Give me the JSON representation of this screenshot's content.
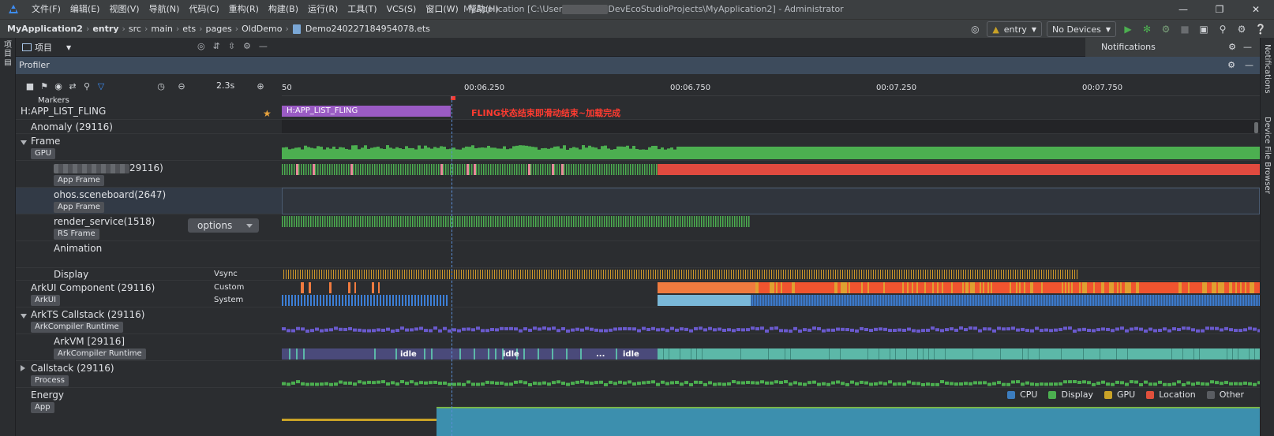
{
  "window": {
    "menus": [
      "文件(F)",
      "编辑(E)",
      "视图(V)",
      "导航(N)",
      "代码(C)",
      "重构(R)",
      "构建(B)",
      "运行(R)",
      "工具(T)",
      "VCS(S)",
      "窗口(W)",
      "帮助(H)"
    ],
    "title_pre": "MyApplication [C:\\User",
    "title_post": "DevEcoStudioProjects\\MyApplication2] - Administrator"
  },
  "nav": {
    "crumbs": [
      "MyApplication2",
      "entry",
      "src",
      "main",
      "ets",
      "pages",
      "OldDemo"
    ],
    "file": "Demo240227184954078.ets",
    "module_select": "entry",
    "device_select": "No Devices"
  },
  "tool": {
    "project_label": "项目",
    "notifications_label": "Notifications",
    "profiler_label": "Profiler",
    "left_stripe": [
      "项目"
    ],
    "right_stripe_notifications": "Notifications",
    "right_stripe_device": "Device File Browser"
  },
  "profiler": {
    "zoom": "2.3s",
    "ticks": [
      {
        "label": "50",
        "t": 0
      },
      {
        "label": "00:06.250",
        "t": 1
      },
      {
        "label": "00:06.750",
        "t": 2
      },
      {
        "label": "00:07.250",
        "t": 3
      },
      {
        "label": "00:07.750",
        "t": 4
      }
    ],
    "markers_title": "Markers",
    "marker_name": "H:APP_LIST_FLING",
    "marker_bar": "H:APP_LIST_FLING",
    "marker_note": "FLING状态结束即滑动结束~加载完成",
    "rows": {
      "anomaly": "Anomaly (29116)",
      "frame": "Frame",
      "frame_tag": "GPU",
      "app_frame_suffix": "29116)",
      "app_frame_tag": "App Frame",
      "sceneboard": "ohos.sceneboard(2647)",
      "sceneboard_tag": "App Frame",
      "render_service": "render_service(1518)",
      "render_tag": "RS Frame",
      "options": "options",
      "animation": "Animation",
      "display": "Display",
      "vsync": "Vsync",
      "arkui": "ArkUI Component (29116)",
      "arkui_tag": "ArkUI",
      "custom": "Custom",
      "system": "System",
      "arkts": "ArkTS Callstack (29116)",
      "arkts_tag": "ArkCompiler Runtime",
      "arkvm": "ArkVM [29116]",
      "arkvm_tag": "ArkCompiler Runtime",
      "callstack": "Callstack (29116)",
      "callstack_tag": "Process",
      "energy": "Energy",
      "energy_tag": "App"
    },
    "idle_labels": [
      "idle",
      "idle",
      "...",
      "idle"
    ],
    "legend": [
      {
        "label": "CPU",
        "color": "#3c7dbf"
      },
      {
        "label": "Display",
        "color": "#4caf50"
      },
      {
        "label": "GPU",
        "color": "#c9a227"
      },
      {
        "label": "Location",
        "color": "#e0503c"
      },
      {
        "label": "Other",
        "color": "#5a5d62"
      }
    ]
  },
  "colors": {
    "frame_green": "#4caf50",
    "jank_red": "#e04a3f",
    "marker_purple": "#9a5bc4",
    "vsync_orange": "#d19a2a",
    "custom_orange": "#f07b3f",
    "system_blue": "#3d7fd6",
    "runtime_purple": "#6a5acd",
    "teal": "#5cb8a8"
  }
}
